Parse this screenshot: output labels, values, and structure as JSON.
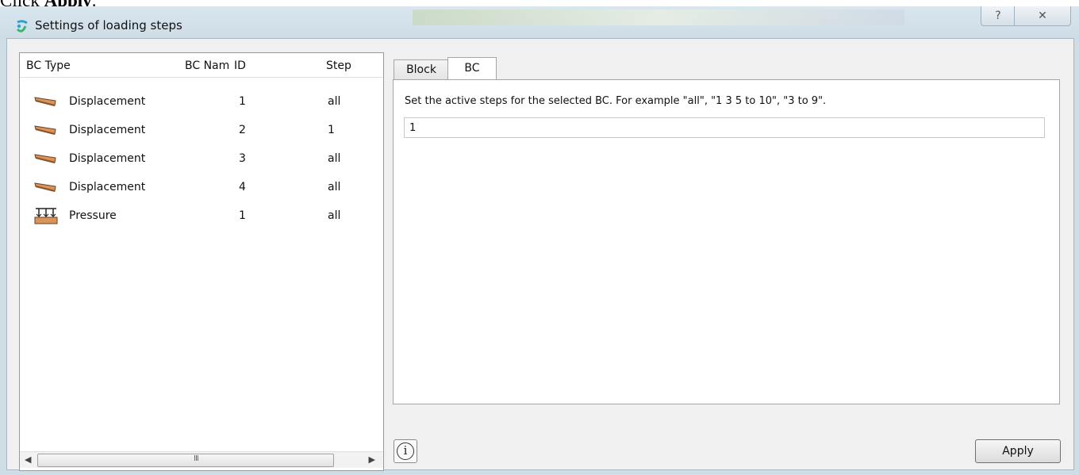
{
  "caption": {
    "prefix": "Click ",
    "bold": "Apply",
    "suffix": "."
  },
  "window": {
    "title": "Settings of loading steps",
    "help_glyph": "?",
    "close_glyph": "✕"
  },
  "table": {
    "headers": [
      "BC Type",
      "BC Nam",
      "ID",
      "Step"
    ],
    "rows": [
      {
        "icon": "displacement-icon",
        "type": "Displacement",
        "id": "1",
        "step": "all"
      },
      {
        "icon": "displacement-icon",
        "type": "Displacement",
        "id": "2",
        "step": "1"
      },
      {
        "icon": "displacement-icon",
        "type": "Displacement",
        "id": "3",
        "step": "all"
      },
      {
        "icon": "displacement-icon",
        "type": "Displacement",
        "id": "4",
        "step": "all"
      },
      {
        "icon": "pressure-icon",
        "type": "Pressure",
        "id": "1",
        "step": "all"
      }
    ],
    "scrollbar": {
      "left_arrow": "◀",
      "right_arrow": "▶",
      "grip": "III"
    }
  },
  "tabs": [
    {
      "label": "Block"
    },
    {
      "label": "BC"
    }
  ],
  "bc_tab": {
    "help_text": "Set the active steps for the selected BC. For example \"all\", \"1 3 5 to 10\", \"3 to 9\".",
    "steps_value": "1"
  },
  "buttons": {
    "info_glyph": "i",
    "apply_label": "Apply"
  }
}
